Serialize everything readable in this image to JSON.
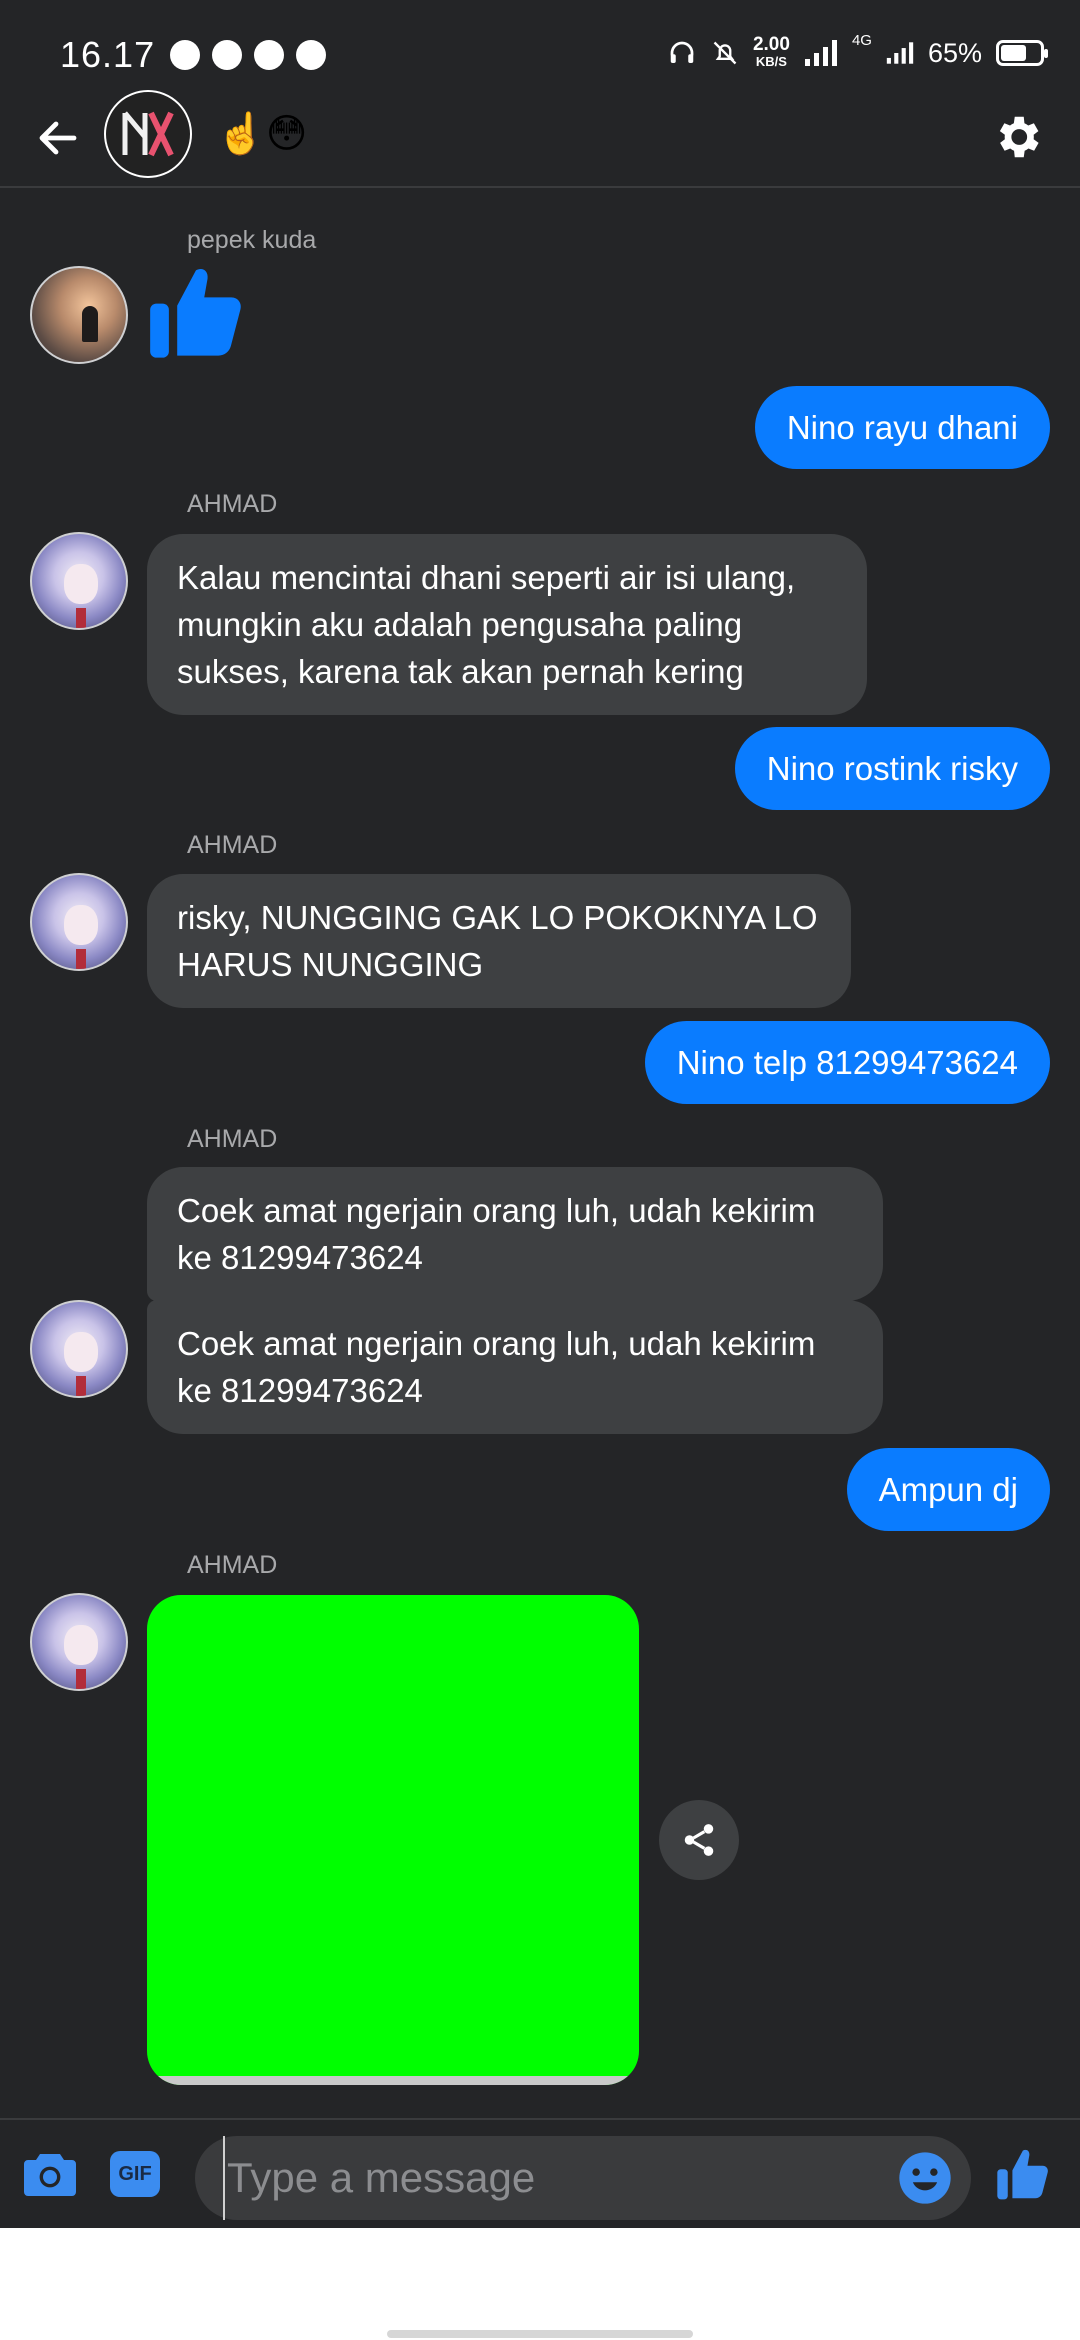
{
  "status_bar": {
    "time": "16.17",
    "net_speed_value": "2.00",
    "net_speed_unit": "KB/S",
    "network": "4G",
    "battery": "65%",
    "battery_level": 0.65
  },
  "header": {
    "group_name": "☝️😳"
  },
  "messages": [
    {
      "type": "like",
      "sender": "pepek kuda"
    },
    {
      "type": "outgoing",
      "text": "Nino rayu dhani"
    },
    {
      "type": "incoming",
      "sender": "AHMAD",
      "text": "Kalau mencintai dhani seperti air isi ulang, mungkin aku adalah pengusaha paling sukses, karena tak akan pernah kering"
    },
    {
      "type": "outgoing",
      "text": "Nino rostink risky"
    },
    {
      "type": "incoming",
      "sender": "AHMAD",
      "text": "risky, NUNGGING GAK LO POKOKNYA LO HARUS NUNGGING"
    },
    {
      "type": "outgoing",
      "text": "Nino telp 81299473624"
    },
    {
      "type": "incoming",
      "sender": "AHMAD",
      "text": "Coek amat ngerjain orang luh, udah kekirim ke 81299473624"
    },
    {
      "type": "incoming",
      "text": "Coek amat ngerjain orang luh, udah kekirim ke 81299473624"
    },
    {
      "type": "outgoing",
      "text": "Ampun dj"
    },
    {
      "type": "image",
      "sender": "AHMAD",
      "color": "#00ff00"
    }
  ],
  "composer": {
    "placeholder": "Type a message",
    "gif_label": "GIF"
  },
  "colors": {
    "background": "#242527",
    "incoming_bubble": "#3e4042",
    "outgoing_bubble": "#0a7cff",
    "accent": "#0a7cff"
  }
}
